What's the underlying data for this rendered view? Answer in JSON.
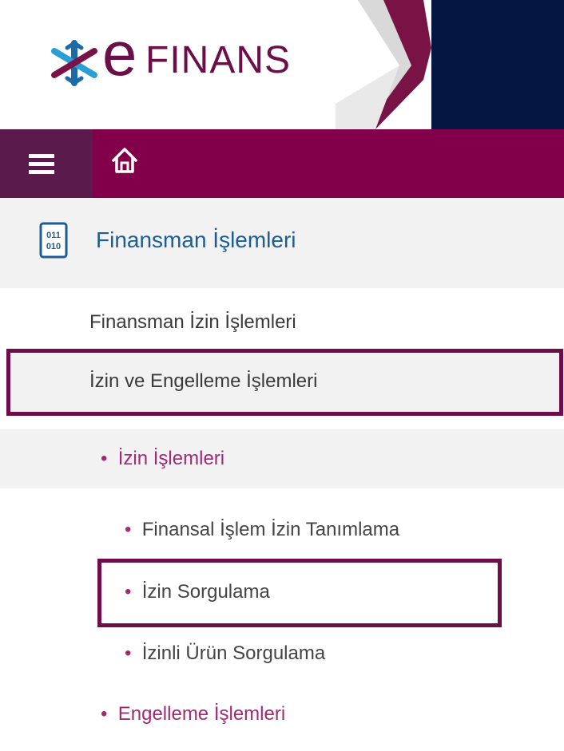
{
  "brand": {
    "logo_icon": "snowflake-asterisk-icon",
    "name_first": "e",
    "name_rest": "FINANS",
    "colors": {
      "brand": "#6b0f48",
      "nav": "#820049",
      "nav_dark": "#5a1a4b",
      "header_dark": "#041742",
      "link": "#1c5d94",
      "accent": "#a12a76",
      "highlight_border": "#6e0d4a"
    }
  },
  "navbar": {
    "menu_icon": "hamburger-menu-icon",
    "home_icon": "home-icon"
  },
  "section": {
    "icon": "binary-code-icon",
    "title": "Finansman İşlemleri"
  },
  "menu": {
    "item1": "Finansman İzin İşlemleri",
    "item2": "İzin ve Engelleme İşlemleri",
    "submenu": {
      "izin_islemleri": "İzin İşlemleri",
      "finansal_islem": "Finansal İşlem İzin Tanımlama",
      "izin_sorgulama": "İzin Sorgulama",
      "izinli_urun": "İzinli Ürün Sorgulama",
      "engelleme": "Engelleme İşlemleri"
    }
  }
}
